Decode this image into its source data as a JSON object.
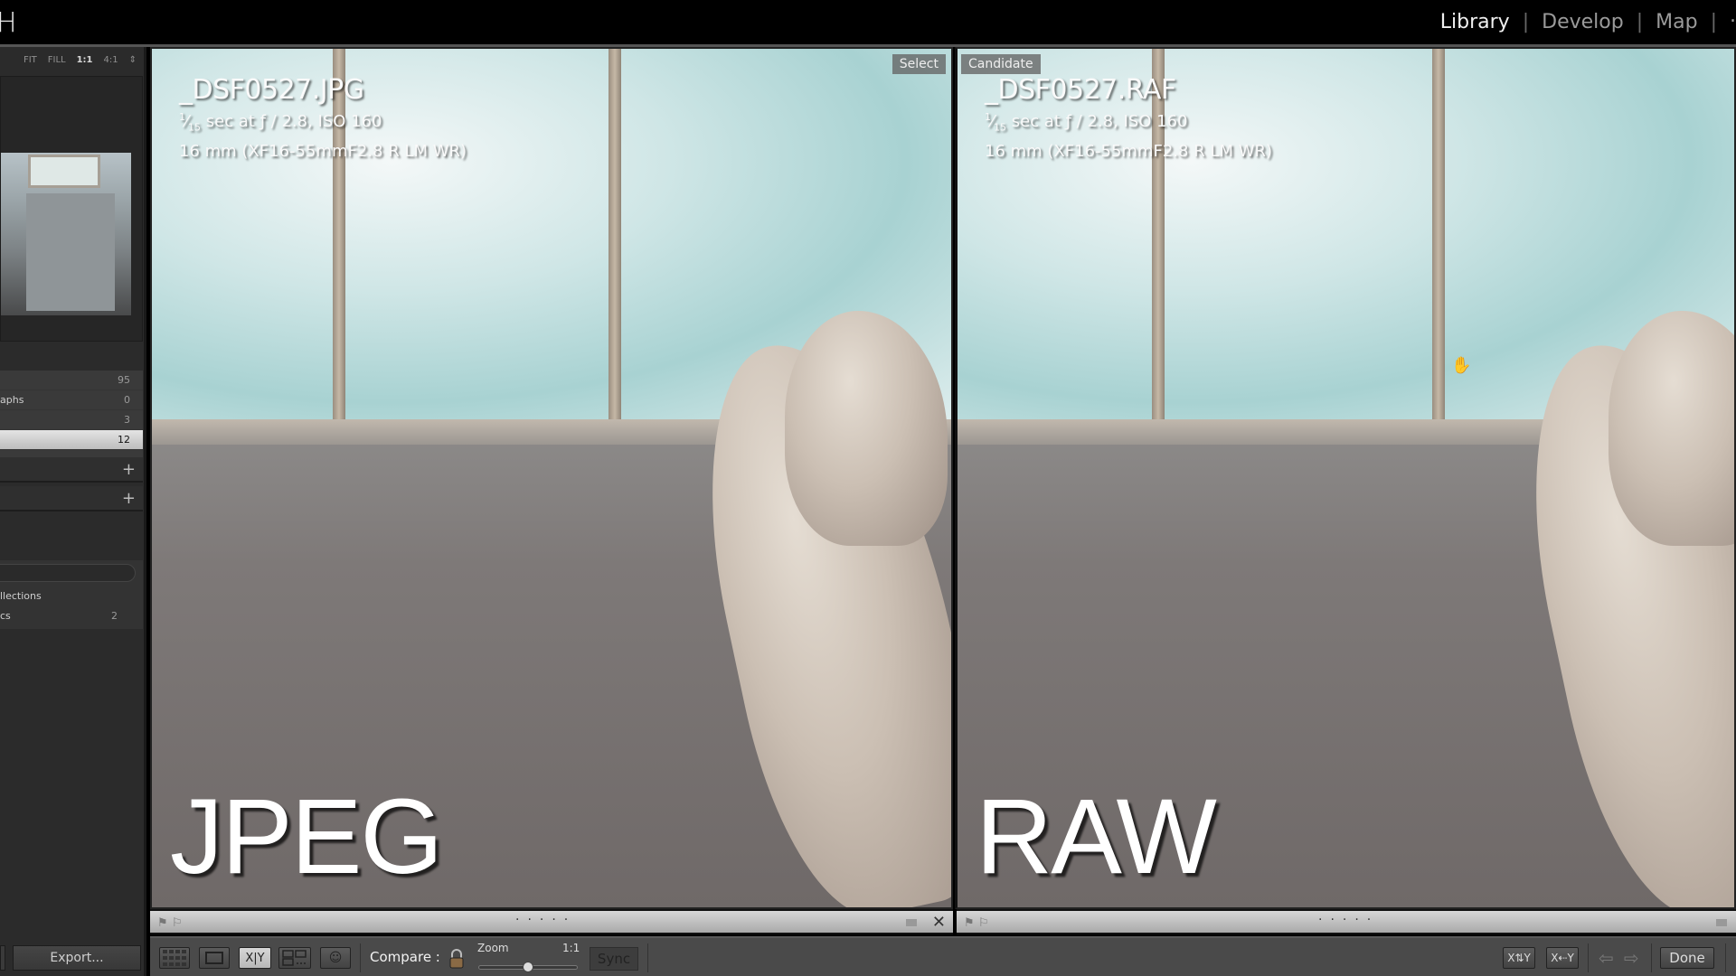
{
  "app": {
    "brand_partial": "H"
  },
  "modules": [
    {
      "label": "Library",
      "active": true
    },
    {
      "label": "Develop",
      "active": false
    },
    {
      "label": "Map",
      "active": false
    }
  ],
  "navigator": {
    "zoom_options": [
      "FIT",
      "FILL",
      "1:1",
      "4:1"
    ],
    "selected_zoom": "1:1"
  },
  "catalog": {
    "rows": [
      {
        "label": "",
        "count": "95"
      },
      {
        "label": "aphs",
        "count": "0"
      },
      {
        "label": "",
        "count": "3"
      },
      {
        "label": "",
        "count": "12",
        "selected": true
      }
    ]
  },
  "collections": {
    "rows": [
      {
        "label": "llections",
        "count": ""
      },
      {
        "label": "cs",
        "count": "2"
      }
    ]
  },
  "left_panel": {
    "export_label": "Export..."
  },
  "compare": {
    "left": {
      "tag": "Select",
      "filename": "_DSF0527.JPG",
      "exposure_num": "1",
      "exposure_den": "15",
      "exposure_rest": " sec at ƒ / 2.8, ISO 160",
      "lens": "16 mm (XF16-55mmF2.8 R LM WR)",
      "overlay_label": "JPEG"
    },
    "right": {
      "tag": "Candidate",
      "filename": "_DSF0527.RAF",
      "exposure_num": "1",
      "exposure_den": "15",
      "exposure_rest": " sec at ƒ / 2.8, ISO 160",
      "lens": "16 mm (XF16-55mmF2.8 R LM WR)",
      "overlay_label": "RAW"
    }
  },
  "toolbar": {
    "compare_label": "Compare :",
    "zoom_label": "Zoom",
    "zoom_value": "1:1",
    "zoom_slider_fraction": 0.5,
    "sync_label": "Sync",
    "swap_label_x": "X",
    "swap_label_y": "Y",
    "done_label": "Done"
  }
}
